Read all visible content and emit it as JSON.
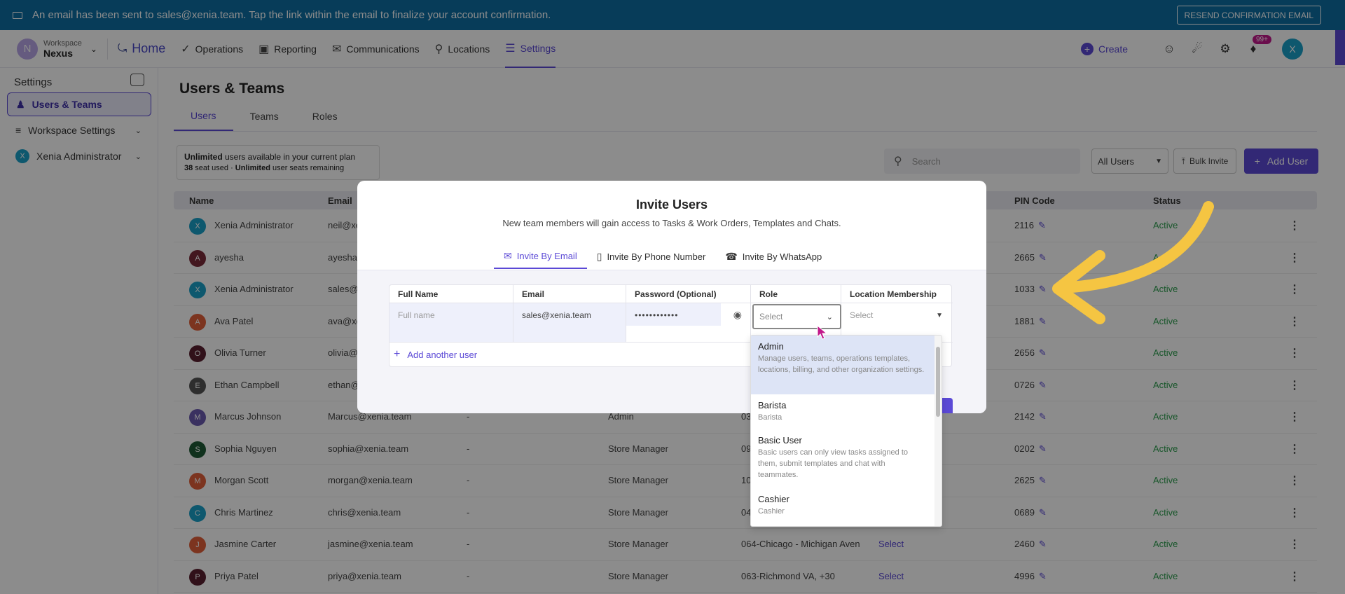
{
  "banner": {
    "message": "An email has been sent to sales@xenia.team. Tap the link within the email to finalize your account confirmation.",
    "resend_label": "RESEND CONFIRMATION EMAIL"
  },
  "nav": {
    "workspace_label": "Workspace",
    "workspace_name": "Nexus",
    "workspace_initial": "N",
    "items": [
      {
        "label": "Home",
        "icon": "home-icon"
      },
      {
        "label": "Operations",
        "icon": "check-circle-icon"
      },
      {
        "label": "Reporting",
        "icon": "chart-icon"
      },
      {
        "label": "Communications",
        "icon": "chat-icon"
      },
      {
        "label": "Locations",
        "icon": "location-pin-icon"
      },
      {
        "label": "Settings",
        "icon": "settings-sliders-icon"
      }
    ],
    "create_label": "Create",
    "notification_badge": "99+",
    "user_initial": "X"
  },
  "sidebar": {
    "title": "Settings",
    "items": [
      {
        "label": "Users & Teams"
      },
      {
        "label": "Workspace Settings"
      },
      {
        "label": "Xenia Administrator"
      }
    ]
  },
  "main": {
    "title": "Users & Teams",
    "tabs": [
      "Users",
      "Teams",
      "Roles"
    ],
    "plan_line1_bold": "Unlimited",
    "plan_line1_rest": " users available in your current plan",
    "plan_line2_count": "38",
    "plan_line2_mid": " seat used · ",
    "plan_line2_bold": "Unlimited",
    "plan_line2_rest": " user seats remaining",
    "search_placeholder": "Search",
    "filter_value": "All Users",
    "bulk_label": "Bulk Invite",
    "add_user_label": "Add User",
    "columns": [
      "Name",
      "Email",
      "PIN Code",
      "Status"
    ]
  },
  "rows": [
    {
      "initial": "X",
      "color": "#1aa0c8",
      "name": "Xenia Administrator",
      "email": "neil@xe",
      "phone": "",
      "role": "",
      "location": "",
      "loc_select": "",
      "pin": "2116",
      "status": "Active"
    },
    {
      "initial": "A",
      "color": "#7a2a3a",
      "name": "ayesha",
      "email": "ayesha",
      "phone": "",
      "role": "",
      "location": "",
      "loc_select": "",
      "pin": "2665",
      "status": "Ac"
    },
    {
      "initial": "X",
      "color": "#1aa0c8",
      "name": "Xenia Administrator",
      "email": "sales@",
      "phone": "",
      "role": "",
      "location": "",
      "loc_select": "",
      "pin": "1033",
      "status": "Active"
    },
    {
      "initial": "A",
      "color": "#e2603a",
      "name": "Ava Patel",
      "email": "ava@xe",
      "phone": "",
      "role": "",
      "location": "",
      "loc_select": "",
      "pin": "1881",
      "status": "Active"
    },
    {
      "initial": "O",
      "color": "#5a2030",
      "name": "Olivia Turner",
      "email": "olivia@",
      "phone": "",
      "role": "",
      "location": "",
      "loc_select": "",
      "pin": "2656",
      "status": "Active"
    },
    {
      "initial": "E",
      "color": "#555555",
      "name": "Ethan Campbell",
      "email": "ethan@",
      "phone": "",
      "role": "",
      "location": "",
      "loc_select": "",
      "pin": "0726",
      "status": "Active"
    },
    {
      "initial": "M",
      "color": "#6a5ab0",
      "name": "Marcus Johnson",
      "email": "Marcus@xenia.team",
      "phone": "-",
      "role": "Admin",
      "location": "03",
      "loc_select": "",
      "pin": "2142",
      "status": "Active"
    },
    {
      "initial": "S",
      "color": "#1e5a36",
      "name": "Sophia Nguyen",
      "email": "sophia@xenia.team",
      "phone": "-",
      "role": "Store Manager",
      "location": "09",
      "loc_select": "",
      "pin": "0202",
      "status": "Active"
    },
    {
      "initial": "M",
      "color": "#e2603a",
      "name": "Morgan Scott",
      "email": "morgan@xenia.team",
      "phone": "-",
      "role": "Store Manager",
      "location": "10",
      "loc_select": "",
      "pin": "2625",
      "status": "Active"
    },
    {
      "initial": "C",
      "color": "#1aa0c8",
      "name": "Chris Martinez",
      "email": "chris@xenia.team",
      "phone": "-",
      "role": "Store Manager",
      "location": "04",
      "loc_select": "",
      "pin": "0689",
      "status": "Active"
    },
    {
      "initial": "J",
      "color": "#e2603a",
      "name": "Jasmine Carter",
      "email": "jasmine@xenia.team",
      "phone": "-",
      "role": "Store Manager",
      "location": "064-Chicago - Michigan Aven",
      "loc_select": "Select",
      "pin": "2460",
      "status": "Active"
    },
    {
      "initial": "P",
      "color": "#5a2030",
      "name": "Priya Patel",
      "email": "priya@xenia.team",
      "phone": "-",
      "role": "Store Manager",
      "location": "063-Richmond VA, +30",
      "loc_select": "Select",
      "pin": "4996",
      "status": "Active"
    }
  ],
  "modal": {
    "title": "Invite Users",
    "subtitle": "New team members will gain access to Tasks & Work Orders, Templates and Chats.",
    "tabs": [
      "Invite By Email",
      "Invite By Phone Number",
      "Invite By WhatsApp"
    ],
    "columns": [
      "Full Name",
      "Email",
      "Password (Optional)",
      "Role",
      "Location Membership"
    ],
    "fullname_placeholder": "Full name",
    "email_value": "sales@xenia.team",
    "password_value": "••••••••••••",
    "role_placeholder": "Select",
    "location_placeholder": "Select",
    "add_another": "Add another user"
  },
  "role_options": [
    {
      "title": "Admin",
      "desc": "Manage users, teams, operations templates, locations, billing, and other organization settings."
    },
    {
      "title": "Barista",
      "desc": "Barista"
    },
    {
      "title": "Basic User",
      "desc": "Basic users can only view tasks assigned to them, submit templates and chat with teammates."
    },
    {
      "title": "Cashier",
      "desc": "Cashier"
    }
  ],
  "colors": {
    "accent": "#5b49d6",
    "banner": "#0e6ea3",
    "status": "#2e9e4f",
    "arrow": "#f5c542"
  }
}
